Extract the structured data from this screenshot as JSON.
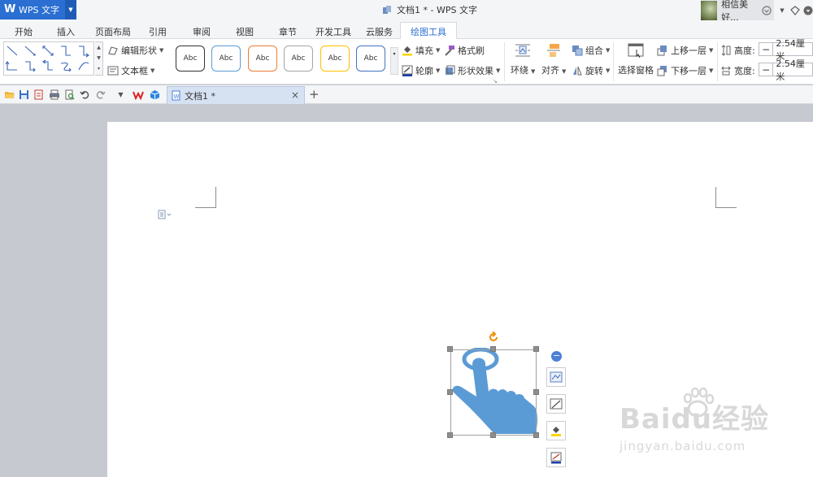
{
  "app": {
    "name": "WPS 文字",
    "logo_letter": "W"
  },
  "window": {
    "title": "文档1 * - WPS 文字"
  },
  "user": {
    "name": "相信美好..."
  },
  "menu": {
    "tabs": [
      "开始",
      "插入",
      "页面布局",
      "引用",
      "审阅",
      "视图",
      "章节",
      "开发工具",
      "云服务",
      "绘图工具"
    ],
    "active": "绘图工具"
  },
  "ribbon": {
    "edit_shape": "编辑形状",
    "text_box": "文本框",
    "style_presets": [
      "Abc",
      "Abc",
      "Abc",
      "Abc",
      "Abc",
      "Abc"
    ],
    "style_colors": [
      "#333333",
      "#5b9bd5",
      "#ed7d31",
      "#a5a5a5",
      "#ffc000",
      "#4472c4"
    ],
    "fill": "填充",
    "format_painter": "格式刷",
    "outline": "轮廓",
    "shape_effects": "形状效果",
    "wrap": "环绕",
    "align": "对齐",
    "group": "组合",
    "rotate": "旋转",
    "selection_pane": "选择窗格",
    "bring_forward": "上移一层",
    "send_backward": "下移一层",
    "height_label": "高度:",
    "height_value": "2.54厘米",
    "width_label": "宽度:",
    "width_value": "2.54厘米"
  },
  "document_tab": {
    "name": "文档1 *"
  },
  "shape": {
    "fill_color": "#5b9bd5",
    "handle_color": "#8e8e8e",
    "rotate_color": "#f08a00"
  },
  "watermark": {
    "main": "Baidu经验",
    "sub": "jingyan.baidu.com"
  }
}
